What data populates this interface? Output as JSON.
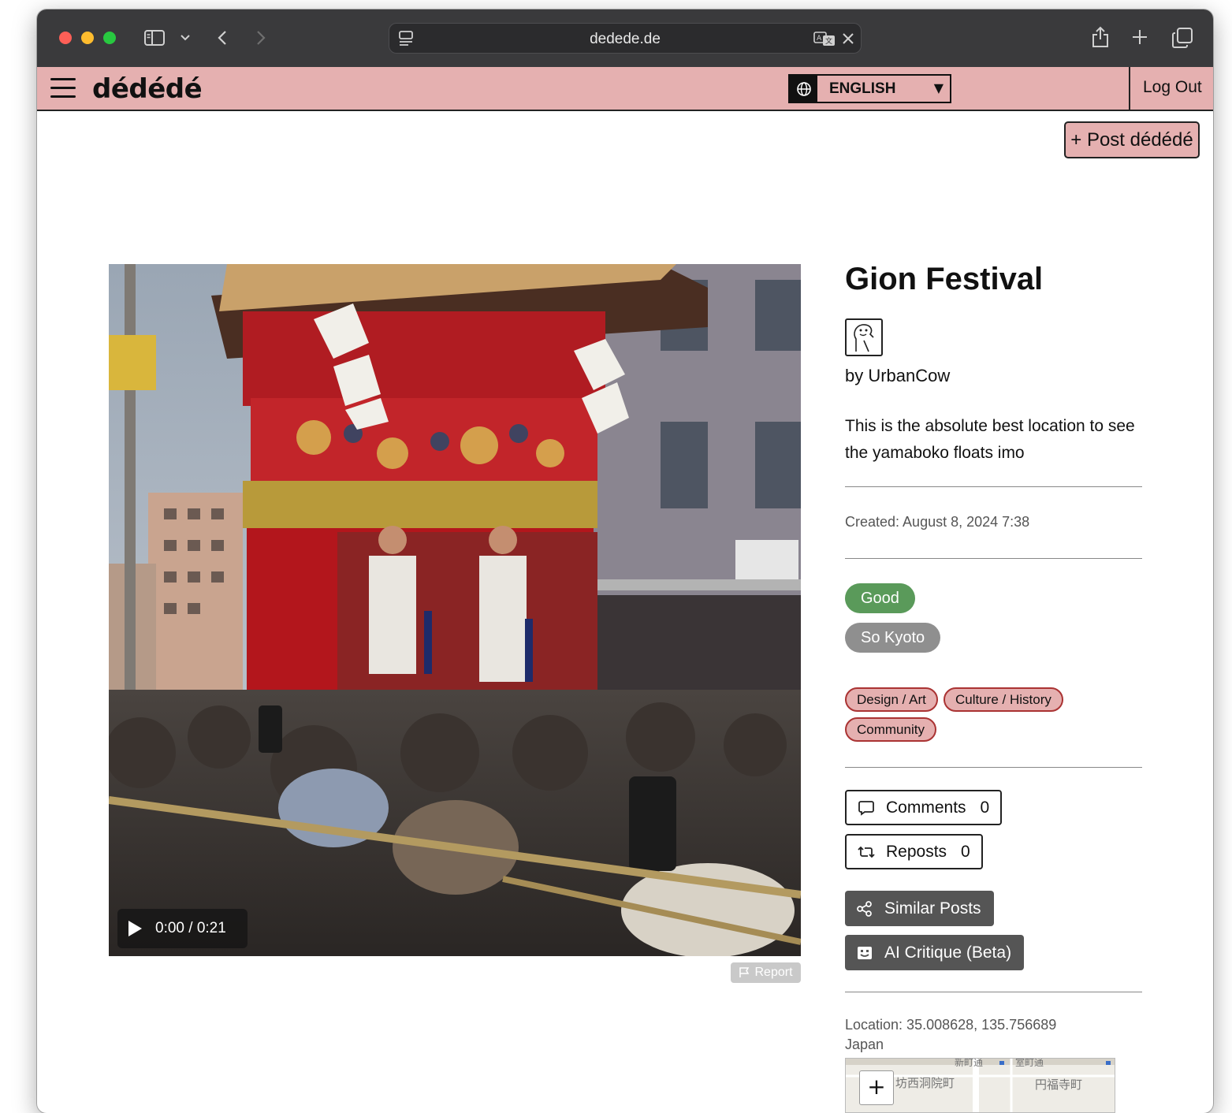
{
  "browser": {
    "url": "dedede.de"
  },
  "nav": {
    "logo": "dédédé",
    "language": "ENGLISH",
    "logout": "Log Out"
  },
  "actions": {
    "post_button": "+ Post dédédé"
  },
  "video": {
    "time": "0:00 / 0:21",
    "report": "Report"
  },
  "post": {
    "title": "Gion Festival",
    "byline": "by UrbanCow",
    "description": "This is the absolute best location to see the yamaboko floats imo",
    "created": "Created: August 8, 2024 7:38",
    "badges": [
      "Good",
      "So Kyoto"
    ],
    "tags": [
      "Design / Art",
      "Culture / History",
      "Community"
    ],
    "comments_label": "Comments",
    "comments_count": "0",
    "reposts_label": "Reposts",
    "reposts_count": "0",
    "similar_posts": "Similar Posts",
    "ai_critique": "AI Critique (Beta)",
    "location": "Location: 35.008628, 135.756689",
    "country": "Japan"
  },
  "map": {
    "zoom_in": "+",
    "labels": [
      "坊西洞院町",
      "円福寺町",
      "新町通",
      "室町通"
    ]
  },
  "colors": {
    "nav_pink": "#e5b0b0",
    "good_green": "#5a9a5a",
    "neutral_gray": "#8f8f8f",
    "dark_button": "#555555"
  }
}
